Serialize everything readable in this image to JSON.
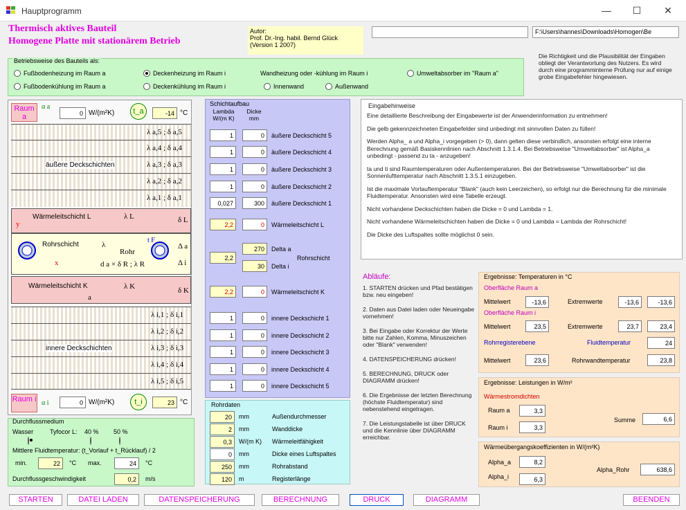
{
  "window": {
    "title": "Hauptprogramm"
  },
  "header": {
    "line1": "Thermisch aktives Bauteil",
    "line2": "Homogene Platte mit stationärem Betrieb"
  },
  "author": {
    "l1": "Autor:",
    "l2": "Prof. Dr.-Ing. habil. Bernd Glück",
    "l3": "(Version 1     2007)"
  },
  "path": {
    "blank": "",
    "value": "F:\\Users\\hannes\\Downloads\\Homogen\\Be"
  },
  "disclaimer": "Die Richtigkeit und die Plausibilität der Eingaben obliegt der Verantwortung des Nutzers. Es wird durch eine programminterne Prüfung nur auf einige grobe Eingabefehler hingewiesen.",
  "betrieb": {
    "title": "Betriebsweise des Bauteils als:",
    "options": [
      "Fußbodenheizung im Raum a",
      "Deckenheizung im Raum i",
      "Wandheizung oder -kühlung im Raum i",
      "Umweltabsorber im \"Raum a\"",
      "Fußbodenkühlung im Raum a",
      "Deckenkühlung im Raum i",
      "Innenwand",
      "Außenwand"
    ]
  },
  "diagram": {
    "raum_a": "Raum a",
    "raum_i": "Raum i",
    "alpha_a_val": "0",
    "alpha_i_val": "0",
    "unit_alpha": "W/(m²K)",
    "ta_label": "t_a",
    "ti_label": "t_i",
    "ta_val": "-14",
    "ti_val": "23",
    "unit_c": "°C",
    "outer_label": "äußere Deckschichten",
    "inner_label": "innere Deckschichten",
    "outer": [
      "λ a,5 ; δ a,5",
      "λ a,4 ; δ a,4",
      "λ a,3 ; δ a,3",
      "λ a,2 ; δ a,2",
      "λ a,1 ; δ a,1"
    ],
    "inner": [
      "λ i,1 ; δ i,1",
      "λ i,2 ; δ i,2",
      "λ i,3 ; δ i,3",
      "λ i,4 ; δ i,4",
      "λ i,5 ; δ i,5"
    ],
    "wl_L": "Wärmeleitschicht L",
    "lambda_L": "λ L",
    "delta_L": "δ L",
    "rohrschicht": "Rohrschicht",
    "lambda": "λ",
    "rohr": "Rohr",
    "tF": "t F",
    "dalabel": "d a × δ R ; λ R",
    "delta_a": "Δ a",
    "delta_i": "Δ i",
    "wl_K": "Wärmeleitschicht K",
    "lambda_K": "λ K",
    "delta_K": "δ K",
    "a": "a",
    "x": "x",
    "y": "y"
  },
  "schicht": {
    "title": "Schichtaufbau",
    "h_lambda": "Lambda W/(m K)",
    "h_dicke": "Dicke mm",
    "rows": [
      {
        "l": "1",
        "d": "0",
        "label": "äußere Deckschicht 5"
      },
      {
        "l": "1",
        "d": "0",
        "label": "äußere Deckschicht 4"
      },
      {
        "l": "1",
        "d": "0",
        "label": "äußere Deckschicht 3"
      },
      {
        "l": "1",
        "d": "0",
        "label": "äußere Deckschicht 2"
      },
      {
        "l": "0,027",
        "d": "300",
        "label": "äußere Deckschicht 1"
      },
      {
        "l": "2,2",
        "d": "0",
        "label": "Wärmeleitschicht L"
      },
      {
        "l": "2,2",
        "d1": "270",
        "d2": "30",
        "label1": "Delta a",
        "label2": "Delta i",
        "label": "Rohrschicht"
      },
      {
        "l": "2,2",
        "d": "0",
        "label": "Wärmeleitschicht K"
      },
      {
        "l": "1",
        "d": "0",
        "label": "innere Deckschicht 1"
      },
      {
        "l": "1",
        "d": "0",
        "label": "innere Deckschicht 2"
      },
      {
        "l": "1",
        "d": "0",
        "label": "innere Deckschicht 3"
      },
      {
        "l": "1",
        "d": "0",
        "label": "innere Deckschicht 4"
      },
      {
        "l": "1",
        "d": "0",
        "label": "innere Deckschicht 5"
      }
    ]
  },
  "rohr": {
    "title": "Rohrdaten",
    "rows": [
      {
        "v": "20",
        "u": "mm",
        "l": "Außendurchmesser"
      },
      {
        "v": "2",
        "u": "mm",
        "l": "Wanddicke"
      },
      {
        "v": "0,3",
        "u": "W/(m K)",
        "l": "Wärmeleitfähigkeit"
      },
      {
        "v": "0",
        "u": "mm",
        "l": "Dicke eines Luftspaltes"
      },
      {
        "v": "250",
        "u": "mm",
        "l": "Rohrabstand"
      },
      {
        "v": "120",
        "u": "m",
        "l": "Registerlänge"
      }
    ]
  },
  "eingabe": {
    "title": "Eingabehinweise",
    "paras": [
      "Eine detaillierte Beschreibung der Eingabewerte ist der Anwenderinformation zu entnehmen!",
      "Die gelb gekennzeichneten Eingabefelder sind unbedingt mit sinnvollen Daten zu füllen!",
      "Werden Alpha_ a und Alpha_i vorgegeben (> 0), dann gelten diese verbindlich, ansonsten erfolgt eine interne Berechnung gemäß Basiskennlinien nach Abschnitt 1.3.1.4. Bei Betriebsweise \"Umweltabsorber\" ist Alpha_a unbedingt - passend zu ta - anzugeben!",
      "ta und ti sind Raumtemperaturen oder Außentemperaturen. Bei der Betriebsweise \"Umweltabsorber\" ist die Sonnenlufttemperatur nach Abschnitt 1.3.5.1 einzugeben.",
      "Ist die maximale Vorlauftemperatur \"Blank\" (auch kein Leerzeichen), so erfolgt nur die Berechnung für die minimale Fluidtemperatur. Ansonsten wird eine Tabelle erzeugt.",
      "Nicht vorhandene Deckschichten haben die Dicke = 0 und Lambda = 1.",
      "Nicht vorhandene Wärmeleitschichten haben die Dicke = 0 und Lambda = Lambda der Rohrschicht!",
      "Die Dicke des Luftspaltes sollte möglichst 0 sein."
    ]
  },
  "ablauf": {
    "title": "Abläufe:",
    "steps": [
      "1. STARTEN drücken und Pfad bestätigen bzw. neu eingeben!",
      "2. Daten aus Datei laden oder Neueingabe vornehmen!",
      "3. Bei Eingabe oder Korrektur der Werte bitte nur Zahlen, Komma, Minuszeichen oder \"Blank\" verwenden!",
      "4. DATENSPEICHERUNG drücken!",
      "5. BERECHNUNG, DRUCK oder DIAGRAMM drücken!",
      "6. Die Ergebnisse der letzten Berechnung (höchste Fluidtemperatur) sind nebenstehend eingetragen.",
      "7. Die Leistungstabelle ist über DRUCK und die Kennlinie über DIAGRAMM erreichbar."
    ]
  },
  "temps": {
    "title": "Ergebnisse: Temperaturen in °C",
    "oa": "Oberfläche Raum a",
    "oi": "Oberfläche Raum i",
    "mittelwert": "Mittelwert",
    "extremwerte": "Extremwerte",
    "a_mw": "-13,6",
    "a_e1": "-13,6",
    "a_e2": "-13,6",
    "i_mw": "23,5",
    "i_e1": "23,7",
    "i_e2": "23,4",
    "rohrreg": "Rohrregisterebene",
    "fluid": "Fluidtemperatur",
    "fluid_v": "24",
    "r_mw": "23,6",
    "rwt": "Rohrwandtemperatur",
    "rwt_v": "23,8"
  },
  "leist": {
    "title": "Ergebnisse: Leistungen in W/m²",
    "wsd": "Wärmestromdichten",
    "ra": "Raum a",
    "ri": "Raum i",
    "ra_v": "3,3",
    "ri_v": "3,3",
    "summe": "Summe",
    "summe_v": "6,6"
  },
  "wuk": {
    "title": "Wärmeübergangskoeffizienten in W/(m²K)",
    "aa": "Alpha_a",
    "ai": "Alpha_i",
    "ar": "Alpha_Rohr",
    "aa_v": "8,2",
    "ai_v": "6,3",
    "ar_v": "638,6"
  },
  "flow": {
    "title": "Durchflussmedium",
    "wasser": "Wasser",
    "tyfocor": "Tyfocor L:",
    "p40": "40 %",
    "p50": "50 %",
    "mittl": "Mittlere Fluidtemperatur: (t_Vorlauf + t_Rücklauf) / 2",
    "min": "min.",
    "min_v": "22",
    "c1": "°C",
    "max": "max.",
    "max_v": "24",
    "c2": "°C",
    "dg": "Durchflussgeschwindigkeit",
    "dg_v": "0,2",
    "ms": "m/s"
  },
  "buttons": {
    "starten": "STARTEN",
    "laden": "DATEI LADEN",
    "speichern": "DATENSPEICHERUNG",
    "berechnung": "BERECHNUNG",
    "druck": "DRUCK",
    "diagramm": "DIAGRAMM",
    "beenden": "BEENDEN"
  },
  "colors": {
    "accent": "#e000e0",
    "yellow": "#ffffc8",
    "green": "#c8f7c8",
    "blue_panel": "#c8c8f7",
    "orange": "#ffe5c8",
    "cyan": "#c8f7f7"
  }
}
